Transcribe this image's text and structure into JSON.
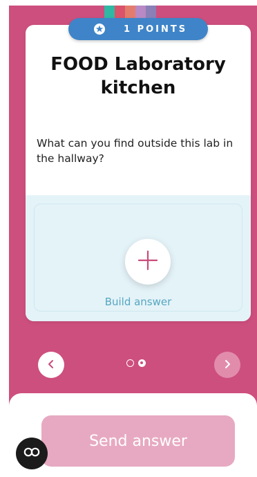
{
  "points": {
    "label": "1 POINTS"
  },
  "card": {
    "title": "FOOD Laboratory kitchen",
    "question": "What can you find outside this lab in the hallway?"
  },
  "answer": {
    "build_label": "Build answer"
  },
  "pager": {
    "total": 2,
    "current": 2
  },
  "actions": {
    "send_label": "Send answer"
  },
  "icons": {
    "points": "star-badge-icon",
    "add": "plus-icon",
    "prev": "chevron-left-icon",
    "next": "chevron-right-icon",
    "captions": "closed-captions-icon"
  },
  "colors": {
    "background": "#cd4f7d",
    "points_pill": "#3f84c8",
    "accent": "#c94a78",
    "send_button": "#e7a9c1",
    "answer_area": "#e4f3f8",
    "build_label": "#56a6c2"
  }
}
